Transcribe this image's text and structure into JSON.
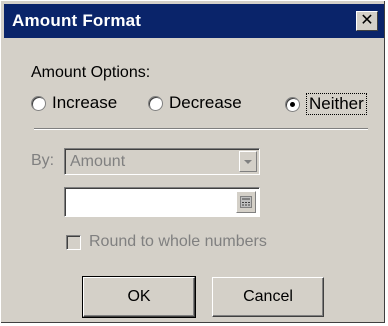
{
  "dialog": {
    "title": "Amount Format",
    "close_symbol": "✕"
  },
  "amount_options": {
    "label": "Amount Options:",
    "options": [
      {
        "label": "Increase",
        "checked": false
      },
      {
        "label": "Decrease",
        "checked": false
      },
      {
        "label": "Neither",
        "checked": true
      }
    ]
  },
  "by": {
    "label": "By:",
    "select_value": "Amount",
    "input_value": ""
  },
  "round_checkbox": {
    "label": "Round to whole numbers",
    "checked": false
  },
  "buttons": {
    "ok": "OK",
    "cancel": "Cancel"
  },
  "colors": {
    "titlebar": "#0a246a",
    "face": "#d4d0c8",
    "disabled_text": "#808080"
  },
  "icons": {
    "close": "close-icon",
    "dropdown": "chevron-down-icon",
    "calculator": "calculator-icon"
  }
}
